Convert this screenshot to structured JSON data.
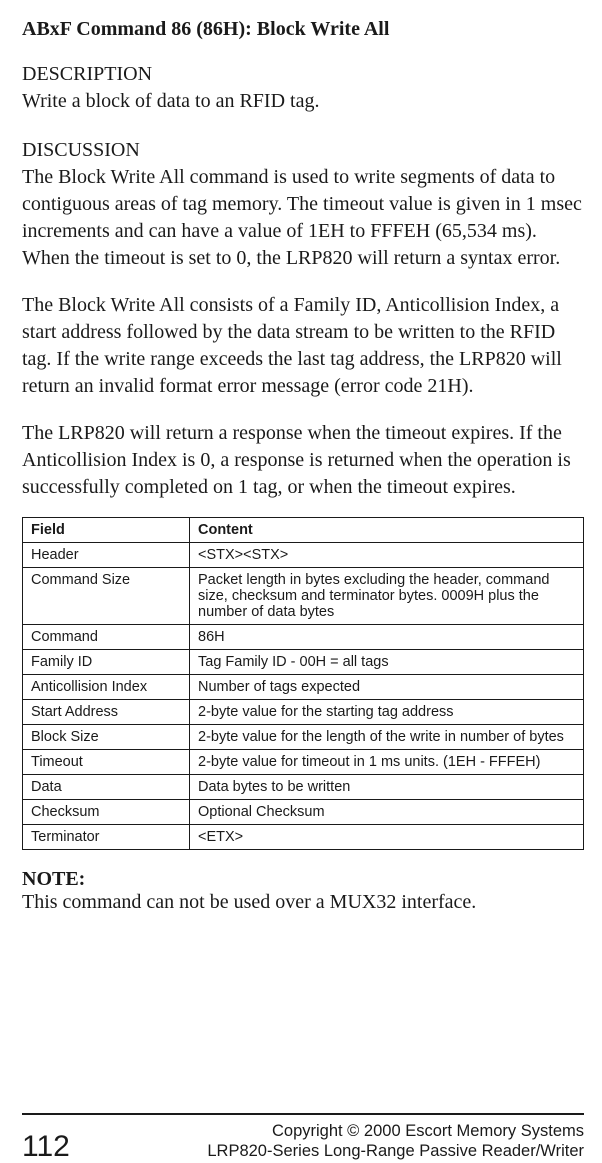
{
  "title": "ABxF Command 86 (86H): Block Write All",
  "description": {
    "heading": "DESCRIPTION",
    "text": "Write a block of data to an RFID tag."
  },
  "discussion": {
    "heading": "DISCUSSION",
    "p1": "The Block Write All command is used to write segments of data to contigu­ous areas of tag memory.  The timeout value is given in 1 msec increments and can have a value of 1EH to FFFEH (65,534 ms).  When the timeout is set to 0, the LRP820 will return a syntax error.",
    "p2": "The Block Write All consists of a Family ID, Anticollision Index, a start ad­dress followed by the data stream to be written to the RFID tag.  If the write range exceeds the last tag address, the LRP820 will return an invalid format error message (error code 21H).",
    "p3": "The LRP820 will return a response when the timeout expires.  If the Anticollision Index is 0, a response is returned when the operation is suc­cessfully completed on 1 tag, or when the timeout expires."
  },
  "table": {
    "headers": {
      "field": "Field",
      "content": "Content"
    },
    "rows": [
      {
        "field": "Header",
        "content": "<STX><STX>"
      },
      {
        "field": "Command Size",
        "content": "Packet length in bytes excluding the header, command size, checksum and terminator bytes.  0009H plus the number of data bytes"
      },
      {
        "field": "Command",
        "content": "86H"
      },
      {
        "field": "Family ID",
        "content": "Tag Family ID - 00H = all tags"
      },
      {
        "field": "Anticollision Index",
        "content": "Number of tags expected"
      },
      {
        "field": "Start Address",
        "content": "2-byte value for the starting tag address"
      },
      {
        "field": "Block Size",
        "content": "2-byte value for the length of the write in number of bytes"
      },
      {
        "field": "Timeout",
        "content": "2-byte value for timeout in 1 ms units. (1EH - FFFEH)"
      },
      {
        "field": "Data",
        "content": "Data bytes to be written"
      },
      {
        "field": "Checksum",
        "content": "Optional Checksum"
      },
      {
        "field": "Terminator",
        "content": "<ETX>"
      }
    ]
  },
  "note": {
    "heading": "NOTE:",
    "text": "This command can not be used over a MUX32 interface."
  },
  "footer": {
    "page": "112",
    "line1": "Copyright © 2000 Escort Memory Systems",
    "line2": "LRP820-Series Long-Range Passive Reader/Writer"
  }
}
